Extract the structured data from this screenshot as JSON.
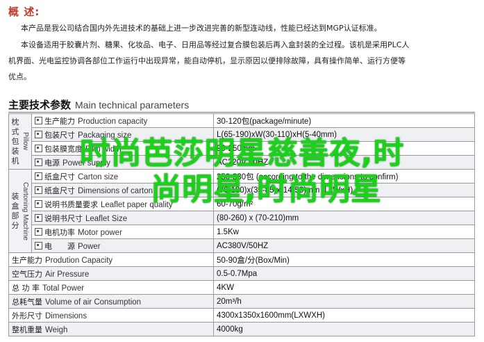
{
  "overview": {
    "title": "概 述:",
    "para1_line1": "本产品是我公司结合国内外先进技术的基础上进一步改进完善的新型连动线，性能已经达到MGP认证标准。",
    "para2_line1": "本设备适用于胶囊片剂、糖果、化妆品、电子、日用品等经过复合膜包装后再入盒封装的全过程。该机是采用PLC人",
    "para2_line2": "机界面、光电监控协调各部位工作运行中出现异常，能自动停机，显示原因以便排除故障，具有操作简单、运行方便等",
    "para2_line3": "优点。"
  },
  "specs": {
    "title_cn": "主要技术参数",
    "title_en": "Main technical parameters",
    "groups": {
      "pillow": {
        "cn": "枕式包装机",
        "en": "Pillow"
      },
      "cartoning": {
        "cn": "装盒部分",
        "en": "Cartoning Machine"
      }
    },
    "rows": [
      {
        "cn": "生产能力",
        "en": "Production capacity",
        "value": "30-120包(package/minute)"
      },
      {
        "cn": "包装尺寸",
        "en": "Packaging size",
        "value": "L(65-190)xW(30-110)xH(5-40mm)"
      },
      {
        "cn": "包装膜宽度",
        "en": "Film width",
        "value": "90-250mm"
      },
      {
        "cn": "电源",
        "en": "Power supply",
        "value": "AC220V 50HZ"
      },
      {
        "cn": "纸盒尺寸",
        "en": "Carton size",
        "value": "250-330包 (according to the dimensions to confirm)"
      },
      {
        "cn": "纸盒尺寸",
        "en": "Dimensions of carton",
        "value": "(70-180)x(35-85)x(14-50)mm (LxWxH)"
      },
      {
        "cn": "说明书质量要求",
        "en": "Leaflet paper quality",
        "value": "60-70g/m²"
      },
      {
        "cn": "说明书尺寸",
        "en": "Leaflet Size",
        "value": "(80-260) x (70-210)mm"
      },
      {
        "cn": "电机功率",
        "en": "Motor power",
        "value": "1.5Kw"
      },
      {
        "cn": "电　　源",
        "en": "Power",
        "value": "AC380V/50HZ"
      },
      {
        "cn": "生产能力",
        "en": "Prodution Capacity",
        "value": "50-90盒/分(Box/Min)"
      },
      {
        "cn": "空气压力",
        "en": "Air Pressure",
        "value": "0.5-0.7Mpa"
      },
      {
        "cn": "总 功 率",
        "en": "Total Power",
        "value": "4KW"
      },
      {
        "cn": "总耗气量",
        "en": "Volume of air Consumption",
        "value": "20m³/h"
      },
      {
        "cn": "外形尺寸",
        "en": "Dimensions",
        "value": "4300x1350x1600mm(LXWXH)"
      },
      {
        "cn": "整机重量",
        "en": "Weigh",
        "value": "4000kg"
      }
    ]
  },
  "overlay": {
    "line1": "时尚芭莎明星慈善夜,时",
    "line2": "尚明星,时尚明星"
  }
}
